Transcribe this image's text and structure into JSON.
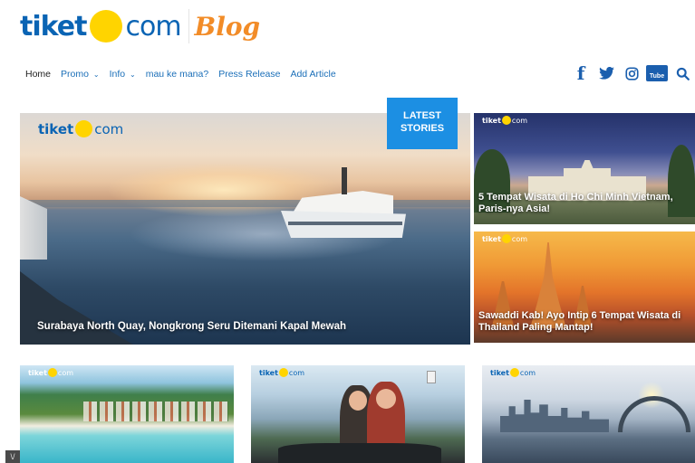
{
  "logo": {
    "part1": "tiket",
    "part2": "com",
    "blog": "Blog"
  },
  "nav": {
    "items": [
      {
        "label": "Home",
        "has_dropdown": false
      },
      {
        "label": "Promo",
        "has_dropdown": true
      },
      {
        "label": "Info",
        "has_dropdown": true
      },
      {
        "label": "mau ke mana?",
        "has_dropdown": false
      },
      {
        "label": "Press Release",
        "has_dropdown": false
      },
      {
        "label": "Add Article",
        "has_dropdown": false
      }
    ],
    "chevron": "⌄"
  },
  "social": {
    "icons": [
      "facebook-icon",
      "twitter-icon",
      "instagram-icon",
      "youtube-icon",
      "search-icon"
    ],
    "facebook_glyph": "f",
    "youtube_top": "You",
    "youtube_bottom": "Tube"
  },
  "latest_badge": {
    "line1": "LATEST",
    "line2": "STORIES"
  },
  "hero": {
    "logo_part1": "tiket",
    "logo_part2": "com",
    "title": "Surabaya North Quay, Nongkrong Seru Ditemani Kapal Mewah"
  },
  "side_cards": [
    {
      "logo_part1": "tiket",
      "logo_part2": "com",
      "title": "5 Tempat Wisata di Ho Chi Minh Vietnam, Paris-nya Asia!"
    },
    {
      "logo_part1": "tiket",
      "logo_part2": "com",
      "title": "Sawaddi Kab! Ayo Intip 6 Tempat Wisata di Thailand Paling Mantap!"
    }
  ],
  "bottom_cards": [
    {
      "logo_part1": "tiket",
      "logo_part2": "com"
    },
    {
      "logo_part1": "tiket",
      "logo_part2": "com"
    },
    {
      "logo_part1": "tiket",
      "logo_part2": "com"
    }
  ],
  "corner_mark": "\\/",
  "colors": {
    "brand_blue": "#0a64b4",
    "brand_yellow": "#ffd400",
    "blog_orange": "#f28c28",
    "badge_blue": "#1c8fe3",
    "nav_blue": "#1b6fb8",
    "social_blue": "#1b5fae"
  }
}
